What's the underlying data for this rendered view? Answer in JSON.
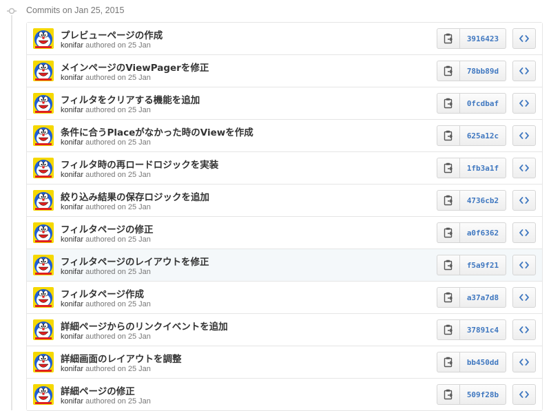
{
  "group": {
    "title": "Commits on Jan 25, 2015"
  },
  "commits": [
    {
      "title": "プレビューページの作成",
      "author": "konifar",
      "action": "authored on 25 Jan",
      "sha": "3916423"
    },
    {
      "title": "メインページのViewPagerを修正",
      "author": "konifar",
      "action": "authored on 25 Jan",
      "sha": "78bb89d"
    },
    {
      "title": "フィルタをクリアする機能を追加",
      "author": "konifar",
      "action": "authored on 25 Jan",
      "sha": "0fcdbaf"
    },
    {
      "title": "条件に合うPlaceがなかった時のViewを作成",
      "author": "konifar",
      "action": "authored on 25 Jan",
      "sha": "625a12c"
    },
    {
      "title": "フィルタ時の再ロードロジックを実装",
      "author": "konifar",
      "action": "authored on 25 Jan",
      "sha": "1fb3a1f"
    },
    {
      "title": "絞り込み結果の保存ロジックを追加",
      "author": "konifar",
      "action": "authored on 25 Jan",
      "sha": "4736cb2"
    },
    {
      "title": "フィルタページの修正",
      "author": "konifar",
      "action": "authored on 25 Jan",
      "sha": "a0f6362"
    },
    {
      "title": "フィルタページのレイアウトを修正",
      "author": "konifar",
      "action": "authored on 25 Jan",
      "sha": "f5a9f21",
      "highlight": true
    },
    {
      "title": "フィルタページ作成",
      "author": "konifar",
      "action": "authored on 25 Jan",
      "sha": "a37a7d8"
    },
    {
      "title": "詳細ページからのリンクイベントを追加",
      "author": "konifar",
      "action": "authored on 25 Jan",
      "sha": "37891c4"
    },
    {
      "title": "詳細画面のレイアウトを調整",
      "author": "konifar",
      "action": "authored on 25 Jan",
      "sha": "bb450dd"
    },
    {
      "title": "詳細ページの修正",
      "author": "konifar",
      "action": "authored on 25 Jan",
      "sha": "509f28b"
    }
  ],
  "icons": {
    "node": "commit-node-icon",
    "copy": "clipboard-icon",
    "browse": "code-icon"
  },
  "colors": {
    "sha": "#4078c0",
    "highlight_row": "#f4f8fa",
    "avatar_blue": "#1e5fd8",
    "avatar_red": "#e02020",
    "avatar_yellow": "#f5d800"
  }
}
